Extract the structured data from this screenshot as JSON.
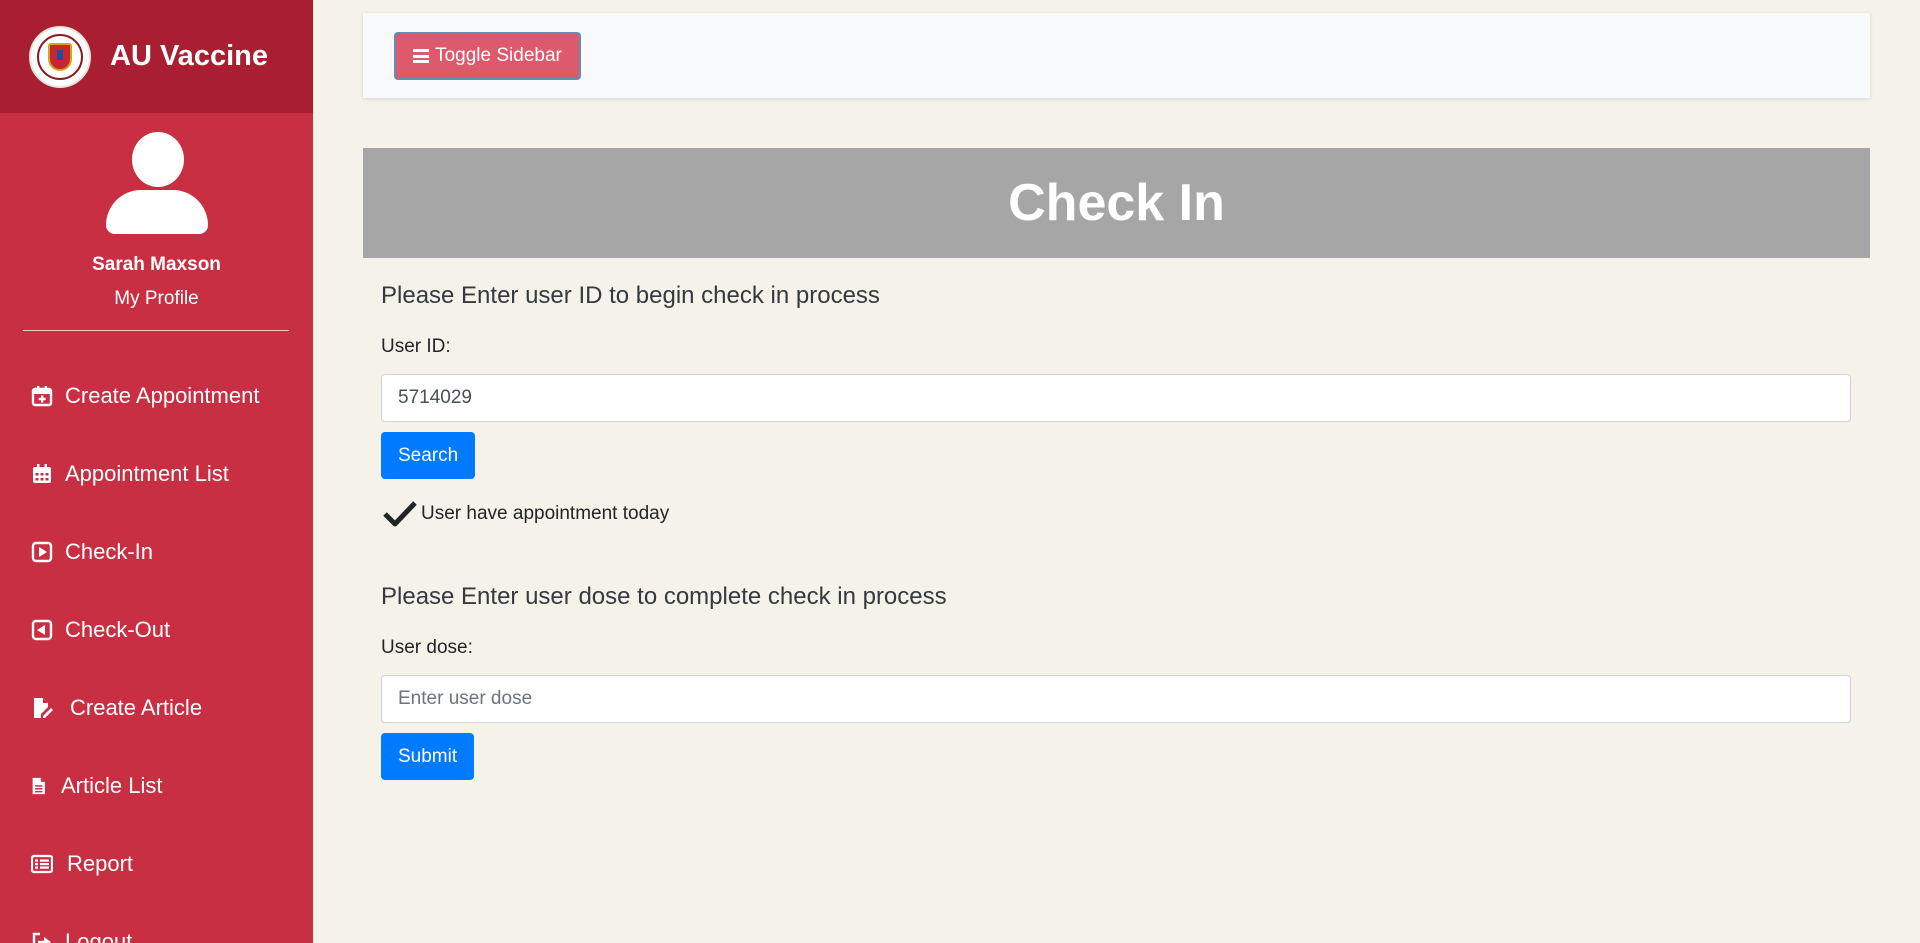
{
  "sidebar": {
    "brand": "AU Vaccine",
    "profile_name": "Sarah Maxson",
    "profile_link": "My Profile",
    "items": [
      {
        "label": "Create Appointment",
        "icon": "calendar-plus-icon"
      },
      {
        "label": "Appointment List",
        "icon": "calendar-grid-icon"
      },
      {
        "label": "Check-In",
        "icon": "arrow-right-square-icon"
      },
      {
        "label": "Check-Out",
        "icon": "arrow-left-square-icon"
      },
      {
        "label": "Create Article",
        "icon": "file-edit-icon"
      },
      {
        "label": "Article List",
        "icon": "file-text-icon"
      },
      {
        "label": "Report",
        "icon": "list-report-icon"
      },
      {
        "label": "Logout",
        "icon": "sign-out-icon"
      }
    ]
  },
  "topbar": {
    "toggle_label": "Toggle Sidebar"
  },
  "page": {
    "title": "Check In"
  },
  "checkin": {
    "lead": "Please Enter user ID to begin check in process",
    "user_id_label": "User ID:",
    "user_id_value": "5714029",
    "search_label": "Search",
    "status_text": "User have appointment today"
  },
  "dose": {
    "lead": "Please Enter user dose to complete check in process",
    "label": "User dose:",
    "placeholder": "Enter user dose",
    "submit_label": "Submit"
  },
  "colors": {
    "sidebar": "#c82f42",
    "brand_bar": "#a91e30",
    "banner": "#a6a6a6",
    "primary": "#007bff",
    "background": "#f5f2ea"
  }
}
